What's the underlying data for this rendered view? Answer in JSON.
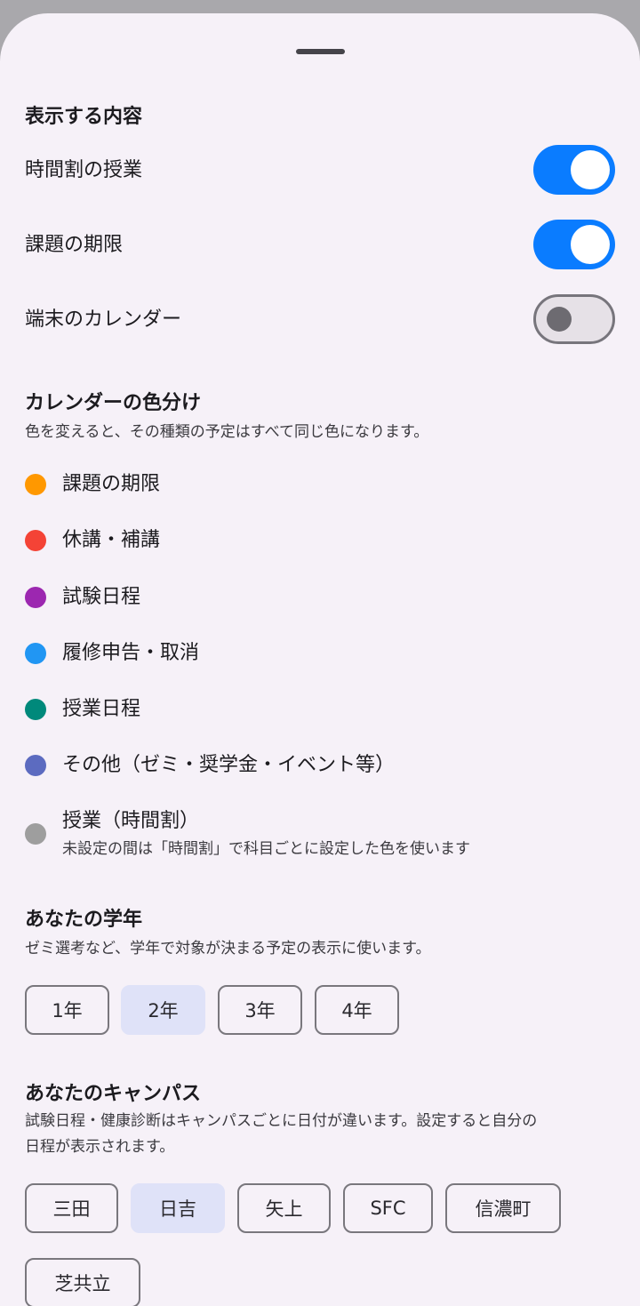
{
  "display": {
    "title": "表示する内容",
    "items": [
      {
        "label": "時間割の授業",
        "on": true
      },
      {
        "label": "課題の期限",
        "on": true
      },
      {
        "label": "端末のカレンダー",
        "on": false
      }
    ]
  },
  "coloring": {
    "title": "カレンダーの色分け",
    "subtitle": "色を変えると、その種類の予定はすべて同じ色になります。",
    "items": [
      {
        "label": "課題の期限",
        "color": "#ff9800"
      },
      {
        "label": "休講・補講",
        "color": "#f44336"
      },
      {
        "label": "試験日程",
        "color": "#9c27b0"
      },
      {
        "label": "履修申告・取消",
        "color": "#2196f3"
      },
      {
        "label": "授業日程",
        "color": "#00897b"
      },
      {
        "label": "その他（ゼミ・奨学金・イベント等）",
        "color": "#5c6bc0"
      },
      {
        "label": "授業（時間割）",
        "sublabel": "未設定の間は「時間割」で科目ごとに設定した色を使います",
        "color": "#9e9e9e"
      }
    ]
  },
  "grade": {
    "title": "あなたの学年",
    "subtitle": "ゼミ選考など、学年で対象が決まる予定の表示に使います。",
    "options": [
      "1年",
      "2年",
      "3年",
      "4年"
    ],
    "selected": "2年"
  },
  "campus": {
    "title": "あなたのキャンパス",
    "subtitle_line1": "試験日程・健康診断はキャンパスごとに日付が違います。設定すると自分の",
    "subtitle_line2": "日程が表示されます。",
    "options": [
      "三田",
      "日吉",
      "矢上",
      "SFC",
      "信濃町",
      "芝共立"
    ],
    "selected": "日吉"
  }
}
